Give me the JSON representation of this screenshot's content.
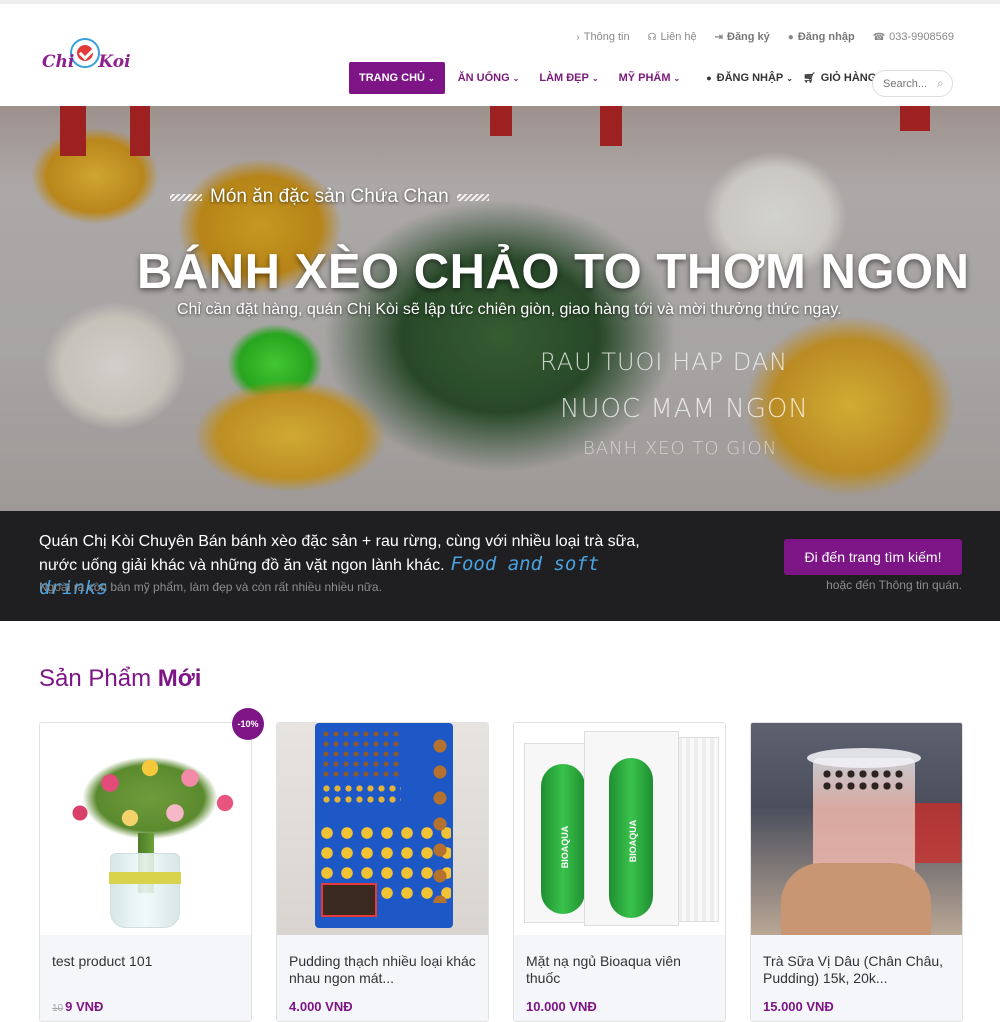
{
  "brand": {
    "logo_part1": "Chi",
    "logo_part2": "Koi"
  },
  "topbar": [
    {
      "icon": "›",
      "label": "Thông tin",
      "bold": false
    },
    {
      "icon": "☊",
      "label": "Liên hệ",
      "bold": false
    },
    {
      "icon": "⇥",
      "label": "Đăng ký",
      "bold": true
    },
    {
      "icon": "●",
      "label": "Đăng nhập",
      "bold": true
    },
    {
      "icon": "☎",
      "label": "033-9908569",
      "bold": false
    }
  ],
  "nav": {
    "home": "TRANG CHỦ",
    "food": "ĂN UỐNG",
    "beauty": "LÀM ĐẸP",
    "cosmetics": "MỸ PHẨM",
    "login": "ĐĂNG NHẬP",
    "cart": "GIỎ HÀNG (0)",
    "search_placeholder": "Search..."
  },
  "hero": {
    "kicker": "Món ăn đặc sản Chứa Chan",
    "title": "BÁNH XÈO CHẢO TO THƠM NGON",
    "subtitle": "Chỉ cần đặt hàng, quán Chị Kòi sẽ lập tức chiên giòn, giao hàng tới và mời thưởng thức ngay.",
    "handwriting": [
      "RAU TUOI HAP DAN",
      "NUOC MAM NGON",
      "BANH XEO TO GION"
    ]
  },
  "banner": {
    "text_line1": "Quán Chị Kòi Chuyên Bán bánh xèo đặc sản + rau rừng, cùng với nhiều loại trà sữa,",
    "text_line2": "nước uống giải khác và những đồ ăn vặt ngon lành khác.",
    "script_text": "Food and soft drinks",
    "note": "Ngoài ra còn bán mỹ phẩm, làm đẹp và còn rất nhiều nhiều nữa.",
    "cta_label": "Đi đến trang tìm kiếm!",
    "cta_note": "hoặc đến Thông tin quán."
  },
  "products": {
    "title_light": "Sản Phẩm",
    "title_bold": "Mới",
    "items": [
      {
        "name": "test product 101",
        "old_price": "10",
        "price": "9 VNĐ",
        "badge": "-10%"
      },
      {
        "name": "Pudding thạch nhiều loại khác nhau ngon mát...",
        "price": "4.000 VNĐ"
      },
      {
        "name": "Mặt nạ ngủ Bioaqua viên thuốc",
        "price": "10.000 VNĐ",
        "brand_text": "BIOAQUA"
      },
      {
        "name": "Trà Sữa Vị Dâu (Chân Châu, Pudding) 15k, 20k...",
        "price": "15.000 VNĐ"
      }
    ]
  },
  "colors": {
    "accent": "#7d1587",
    "banner_bg": "#1f1e20",
    "script_blue": "#49a3e0"
  }
}
